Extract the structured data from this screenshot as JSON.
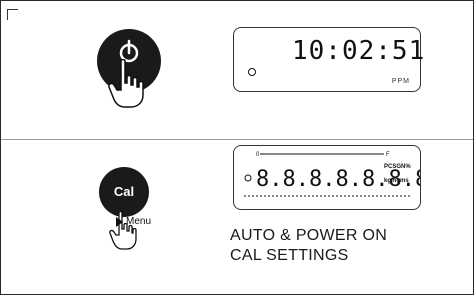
{
  "power_section": {
    "icon": "power-icon",
    "display_value": "10:02:51",
    "display_unit": "PPM"
  },
  "cal_section": {
    "button_label": "Cal",
    "menu_label": "Menu",
    "display_segments": "8.8.8.8.8.8.8.8.8",
    "display_flags": "0 — F  PCSGN%  kgmgms",
    "caption_line1": "AUTO &  POWER ON",
    "caption_line2": "CAL SETTINGS"
  },
  "colors": {
    "button": "#1a1a1a",
    "border": "#2a2a2a",
    "text": "#1a1a1a"
  }
}
